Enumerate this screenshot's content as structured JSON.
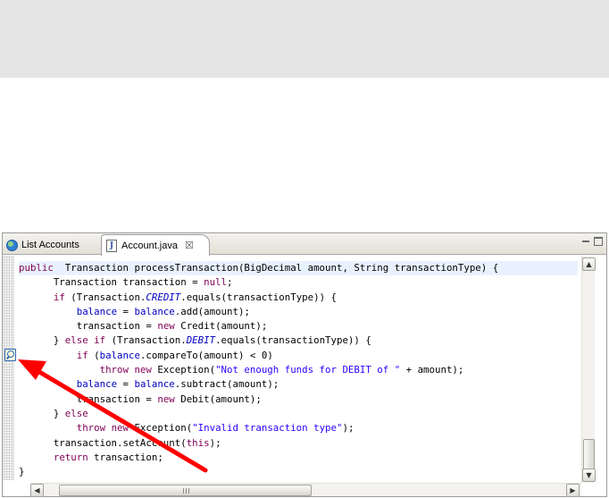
{
  "tabs": [
    {
      "label": "List Accounts",
      "icon": "globe-icon"
    },
    {
      "label": "Account.java",
      "icon": "java-file-icon",
      "close": "☒"
    }
  ],
  "code_lines": [
    {
      "segs": [
        [
          "kw",
          "public"
        ],
        [
          "",
          "  Transaction processTransaction(BigDecimal amount, String transactionType) {"
        ]
      ],
      "hl": true
    },
    {
      "segs": [
        [
          "",
          "      Transaction transaction = "
        ],
        [
          "kw",
          "null"
        ],
        [
          "",
          ";"
        ]
      ]
    },
    {
      "segs": [
        [
          "",
          "      "
        ],
        [
          "kw",
          "if"
        ],
        [
          "",
          " (Transaction."
        ],
        [
          "sfld",
          "CREDIT"
        ],
        [
          "",
          ".equals(transactionType)) {"
        ]
      ]
    },
    {
      "segs": [
        [
          "",
          "          "
        ],
        [
          "fld",
          "balance"
        ],
        [
          "",
          " = "
        ],
        [
          "fld",
          "balance"
        ],
        [
          "",
          ".add(amount);"
        ]
      ]
    },
    {
      "segs": [
        [
          "",
          "          transaction = "
        ],
        [
          "kw",
          "new"
        ],
        [
          "",
          " Credit(amount);"
        ]
      ]
    },
    {
      "segs": [
        [
          "",
          "      } "
        ],
        [
          "kw",
          "else if"
        ],
        [
          "",
          " (Transaction."
        ],
        [
          "sfld",
          "DEBIT"
        ],
        [
          "",
          ".equals(transactionType)) {"
        ]
      ]
    },
    {
      "segs": [
        [
          "",
          "          "
        ],
        [
          "kw",
          "if"
        ],
        [
          "",
          " ("
        ],
        [
          "fld",
          "balance"
        ],
        [
          "",
          ".compareTo(amount) < 0)"
        ]
      ]
    },
    {
      "segs": [
        [
          "",
          "              "
        ],
        [
          "kw",
          "throw new"
        ],
        [
          "",
          " Exception("
        ],
        [
          "str",
          "\"Not enough funds for DEBIT of \""
        ],
        [
          "",
          " + amount);"
        ]
      ]
    },
    {
      "segs": [
        [
          "",
          "          "
        ],
        [
          "fld",
          "balance"
        ],
        [
          "",
          " = "
        ],
        [
          "fld",
          "balance"
        ],
        [
          "",
          ".subtract(amount);"
        ]
      ]
    },
    {
      "segs": [
        [
          "",
          "          transaction = "
        ],
        [
          "kw",
          "new"
        ],
        [
          "",
          " Debit(amount);"
        ]
      ]
    },
    {
      "segs": [
        [
          "",
          "      } "
        ],
        [
          "kw",
          "else"
        ]
      ]
    },
    {
      "segs": [
        [
          "",
          "          "
        ],
        [
          "kw",
          "throw new"
        ],
        [
          "",
          " Exception("
        ],
        [
          "str",
          "\"Invalid transaction type\""
        ],
        [
          "",
          ");"
        ]
      ]
    },
    {
      "segs": [
        [
          "",
          "      transaction.setAccount("
        ],
        [
          "kw",
          "this"
        ],
        [
          "",
          ");"
        ]
      ]
    },
    {
      "segs": [
        [
          "",
          "      "
        ],
        [
          "kw",
          "return"
        ],
        [
          "",
          " transaction;"
        ]
      ]
    },
    {
      "segs": [
        [
          "",
          "}"
        ]
      ]
    }
  ],
  "scrollbars": {
    "up": "▲",
    "down": "▼",
    "left": "◀",
    "right": "▶"
  },
  "annotation": {
    "type": "arrow",
    "color": "#ff0000",
    "points_to": "quick-fix-marker"
  },
  "colors": {
    "keyword": "#7f0055",
    "field": "#0000c0",
    "string": "#2a00ff",
    "highlight": "#e8f2fe"
  }
}
